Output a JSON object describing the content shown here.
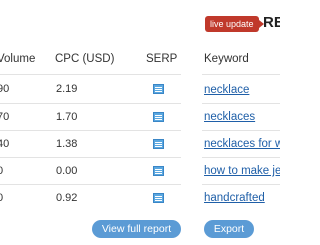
{
  "header": {
    "badge": "live update",
    "title": "RE"
  },
  "left_table": {
    "columns": [
      "Volume",
      "CPC (USD)",
      "SERP"
    ],
    "rows": [
      {
        "volume": "90",
        "cpc": "2.19"
      },
      {
        "volume": "70",
        "cpc": "1.70"
      },
      {
        "volume": "40",
        "cpc": "1.38"
      },
      {
        "volume": "0",
        "cpc": "0.00"
      },
      {
        "volume": "0",
        "cpc": "0.92"
      }
    ],
    "button": "View full report"
  },
  "right_table": {
    "column": "Keyword",
    "rows": [
      {
        "keyword": "necklace"
      },
      {
        "keyword": "necklaces"
      },
      {
        "keyword": "necklaces for w"
      },
      {
        "keyword": "how to make je"
      },
      {
        "keyword": "handcrafted"
      }
    ],
    "button": "Export"
  },
  "colors": {
    "badge": "#c0392b",
    "link": "#1f5fa8",
    "button": "#5b9bd5",
    "serp_icon": "#5aa7e0"
  },
  "icons": {
    "serp": "serp-icon"
  }
}
